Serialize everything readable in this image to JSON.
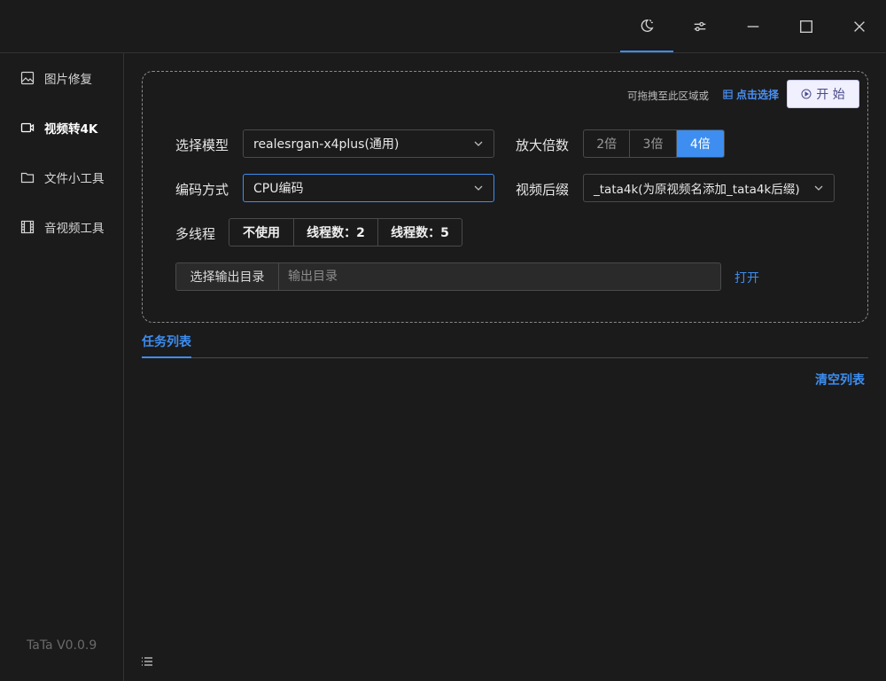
{
  "titlebar": {
    "buttons": [
      {
        "name": "theme-moon-icon",
        "active": true
      },
      {
        "name": "settings-sliders-icon",
        "active": false
      },
      {
        "name": "minimize-icon",
        "active": false
      },
      {
        "name": "maximize-icon",
        "active": false
      },
      {
        "name": "close-icon",
        "active": false
      }
    ]
  },
  "sidebar": {
    "items": [
      {
        "label": "图片修复",
        "icon": "image-icon"
      },
      {
        "label": "视频转4K",
        "icon": "video-camera-icon",
        "active": true
      },
      {
        "label": "文件小工具",
        "icon": "folder-icon"
      },
      {
        "label": "音视频工具",
        "icon": "film-icon"
      }
    ],
    "version": "TaTa V0.0.9"
  },
  "panel": {
    "drop_hint": "可拖拽至此区域或",
    "pick_label": "点击选择",
    "start_label": "开 始",
    "model_label": "选择模型",
    "model_value": "realesrgan-x4plus(通用)",
    "scale_label": "放大倍数",
    "scale_options": [
      "2倍",
      "3倍",
      "4倍"
    ],
    "scale_selected": "4倍",
    "encode_label": "编码方式",
    "encode_value": "CPU编码",
    "suffix_label": "视频后缀",
    "suffix_value": "_tata4k(为原视频名添加_tata4k后缀)",
    "thread_label": "多线程",
    "thread_options": [
      "不使用",
      "线程数：2",
      "线程数：5"
    ],
    "outdir_button": "选择输出目录",
    "outdir_placeholder": "输出目录",
    "open_label": "打开"
  },
  "tasks": {
    "tab_label": "任务列表",
    "clear_label": "清空列表"
  },
  "colors": {
    "accent": "#3d8ef0",
    "background": "#1b1b1c"
  }
}
